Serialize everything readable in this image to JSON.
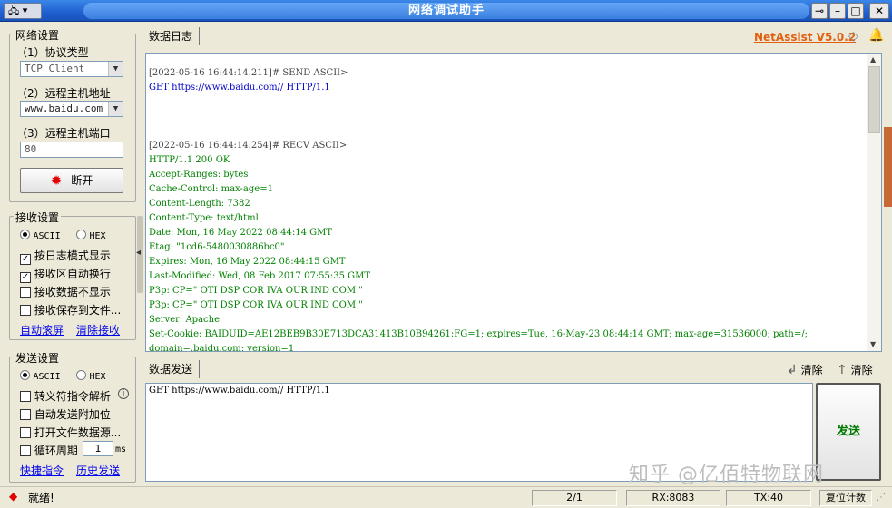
{
  "window": {
    "title": "网络调试助手",
    "brand": "NetAssist V5.0.2",
    "brand_color": "#e06010"
  },
  "network": {
    "group_label": "网络设置",
    "protocol_label": "（1）协议类型",
    "protocol_value": "TCP Client",
    "host_label": "（2）远程主机地址",
    "host_value": "www.baidu.com",
    "port_label": "（3）远程主机端口",
    "port_value": "80",
    "disconnect_label": "断开"
  },
  "receive": {
    "group_label": "接收设置",
    "ascii_label": "ASCII",
    "hex_label": "HEX",
    "options": [
      "按日志模式显示",
      "接收区自动换行",
      "接收数据不显示",
      "接收保存到文件..."
    ],
    "options_checked": [
      "true",
      "true",
      "false",
      "false"
    ],
    "auto_scroll_link": "自动滚屏",
    "clear_link": "清除接收"
  },
  "send": {
    "group_label": "发送设置",
    "ascii_label": "ASCII",
    "hex_label": "HEX",
    "escape_label": "转义符指令解析",
    "append_label": "自动发送附加位",
    "open_file_label": "打开文件数据源...",
    "cycle_label": "循环周期",
    "cycle_value": "1",
    "cycle_unit": "ms",
    "shortcut_link": "快捷指令",
    "history_link": "历史发送"
  },
  "log": {
    "tab_label": "数据日志",
    "lines": [
      {
        "text": "[2022-05-16 16:44:14.211]# SEND ASCII>",
        "color": "#444444"
      },
      {
        "text": "GET https://www.baidu.com// HTTP/1.1",
        "color": "#0000cc"
      },
      {
        "text": "",
        "color": "#000000"
      },
      {
        "text": "",
        "color": "#000000"
      },
      {
        "text": "",
        "color": "#000000"
      },
      {
        "text": "[2022-05-16 16:44:14.254]# RECV ASCII>",
        "color": "#444444"
      },
      {
        "text": "HTTP/1.1 200 OK",
        "color": "#008000"
      },
      {
        "text": "Accept-Ranges: bytes",
        "color": "#008000"
      },
      {
        "text": "Cache-Control: max-age=1",
        "color": "#008000"
      },
      {
        "text": "Content-Length: 7382",
        "color": "#008000"
      },
      {
        "text": "Content-Type: text/html",
        "color": "#008000"
      },
      {
        "text": "Date: Mon, 16 May 2022 08:44:14 GMT",
        "color": "#008000"
      },
      {
        "text": "Etag: \"1cd6-5480030886bc0\"",
        "color": "#008000"
      },
      {
        "text": "Expires: Mon, 16 May 2022 08:44:15 GMT",
        "color": "#008000"
      },
      {
        "text": "Last-Modified: Wed, 08 Feb 2017 07:55:35 GMT",
        "color": "#008000"
      },
      {
        "text": "P3p: CP=\" OTI DSP COR IVA OUR IND COM \"",
        "color": "#008000"
      },
      {
        "text": "P3p: CP=\" OTI DSP COR IVA OUR IND COM \"",
        "color": "#008000"
      },
      {
        "text": "Server: Apache",
        "color": "#008000"
      },
      {
        "text": "Set-Cookie: BAIDUID=AE12BEB9B30E713DCA31413B10B94261:FG=1; expires=Tue, 16-May-23 08:44:14 GMT; max-age=31536000; path=/;",
        "color": "#008000"
      },
      {
        "text": "domain=.baidu.com; version=1",
        "color": "#008000"
      }
    ]
  },
  "sendarea": {
    "tab_label": "数据发送",
    "clear_label_1": "清除",
    "clear_label_2": "清除",
    "content": "GET https://www.baidu.com// HTTP/1.1",
    "send_button": "发送"
  },
  "status": {
    "ready": "就绪!",
    "pages": "2/1",
    "rx": "RX:8083",
    "tx": "TX:40",
    "reset": "复位计数"
  },
  "watermark": "知乎 @亿佰特物联网"
}
